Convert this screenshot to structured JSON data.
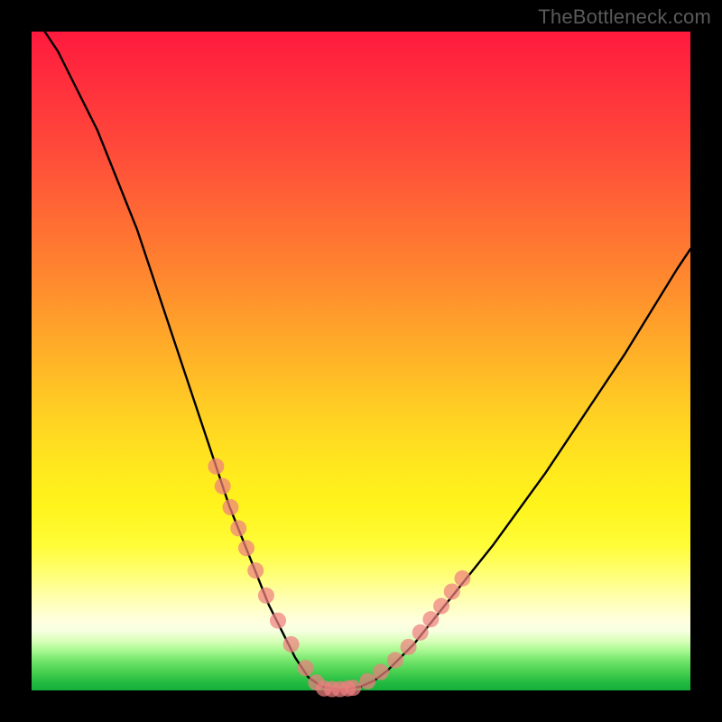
{
  "attribution": "TheBottleneck.com",
  "chart_data": {
    "type": "line",
    "title": "",
    "xlabel": "",
    "ylabel": "",
    "xlim": [
      0,
      100
    ],
    "ylim": [
      0,
      100
    ],
    "grid": false,
    "legend": false,
    "note": "Values read in relative percent of plot area; the image has no axis ticks or numeric labels. Curve is a steep V reaching ~0 near x≈45 with a flat bottom, left arm steeper than right. Pink dots sit on both arms in the lower third.",
    "series": [
      {
        "name": "bottleneck-curve",
        "color": "#000000",
        "x": [
          2,
          4,
          6,
          8,
          10,
          12,
          14,
          16,
          18,
          20,
          22,
          24,
          26,
          28,
          30,
          32,
          34,
          36,
          38,
          40,
          42,
          44,
          46,
          48,
          50,
          52,
          54,
          56,
          58,
          60,
          62,
          66,
          70,
          74,
          78,
          82,
          86,
          90,
          94,
          98,
          100
        ],
        "y": [
          100,
          97,
          93,
          89,
          85,
          80,
          75,
          70,
          64,
          58,
          52,
          46,
          40,
          34,
          28,
          23,
          18,
          13,
          9,
          5,
          2,
          0.6,
          0.2,
          0.2,
          0.6,
          1.5,
          3,
          5,
          7,
          9.5,
          12,
          17,
          22,
          27.5,
          33,
          39,
          45,
          51,
          57.5,
          64,
          67
        ]
      },
      {
        "name": "left-arm-dots",
        "type": "scatter",
        "color": "#ef7f7f",
        "x": [
          28.0,
          29.0,
          30.2,
          31.4,
          32.6,
          34.0,
          35.6,
          37.4,
          39.4,
          41.6,
          43.2
        ],
        "y": [
          34.0,
          31.0,
          27.8,
          24.6,
          21.6,
          18.2,
          14.4,
          10.6,
          7.0,
          3.4,
          1.2
        ]
      },
      {
        "name": "right-arm-dots",
        "type": "scatter",
        "color": "#ef7f7f",
        "x": [
          48.8,
          51.0,
          53.0,
          55.2,
          57.2,
          59.0,
          60.6,
          62.2,
          63.8,
          65.4
        ],
        "y": [
          0.4,
          1.4,
          2.8,
          4.6,
          6.6,
          8.8,
          10.8,
          12.8,
          15.0,
          17.0
        ]
      },
      {
        "name": "floor-dots",
        "type": "scatter",
        "color": "#ef7f7f",
        "x": [
          44.4,
          45.6,
          46.8,
          48.0
        ],
        "y": [
          0.3,
          0.2,
          0.2,
          0.3
        ]
      }
    ]
  }
}
